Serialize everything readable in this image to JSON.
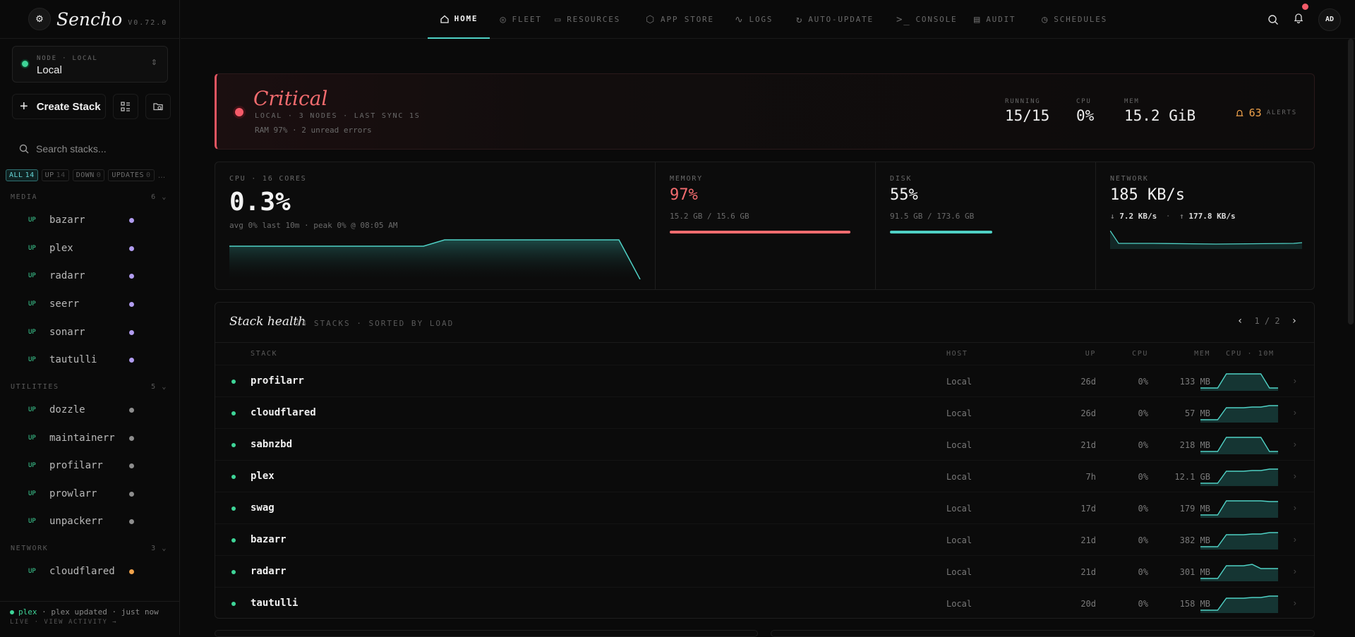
{
  "app": {
    "name": "Sencho",
    "version": "V0.72.0"
  },
  "node": {
    "label": "NODE · LOCAL",
    "value": "Local"
  },
  "sidebar": {
    "create_label": "Create Stack",
    "search_placeholder": "Search stacks...",
    "filters": [
      {
        "label": "ALL",
        "count": "14",
        "active": true
      },
      {
        "label": "UP",
        "count": "14"
      },
      {
        "label": "DOWN",
        "count": "0"
      },
      {
        "label": "UPDATES",
        "count": "0"
      }
    ],
    "groups": [
      {
        "name": "MEDIA",
        "count": "6 ⌄",
        "items": [
          {
            "status": "UP",
            "name": "bazarr",
            "color": "#b19cf0"
          },
          {
            "status": "UP",
            "name": "plex",
            "color": "#b19cf0"
          },
          {
            "status": "UP",
            "name": "radarr",
            "color": "#b19cf0"
          },
          {
            "status": "UP",
            "name": "seerr",
            "color": "#b19cf0"
          },
          {
            "status": "UP",
            "name": "sonarr",
            "color": "#b19cf0"
          },
          {
            "status": "UP",
            "name": "tautulli",
            "color": "#b19cf0"
          }
        ]
      },
      {
        "name": "UTILITIES",
        "count": "5 ⌄",
        "items": [
          {
            "status": "UP",
            "name": "dozzle",
            "color": "#8d8d8d"
          },
          {
            "status": "UP",
            "name": "maintainerr",
            "color": "#8d8d8d"
          },
          {
            "status": "UP",
            "name": "profilarr",
            "color": "#8d8d8d"
          },
          {
            "status": "UP",
            "name": "prowlarr",
            "color": "#8d8d8d"
          },
          {
            "status": "UP",
            "name": "unpackerr",
            "color": "#8d8d8d"
          }
        ]
      },
      {
        "name": "NETWORK",
        "count": "3 ⌄",
        "items": [
          {
            "status": "UP",
            "name": "cloudflared",
            "color": "#f0a24b"
          }
        ]
      }
    ],
    "activity": {
      "name": "plex",
      "text": "· plex updated · just now",
      "line2": "LIVE · VIEW ACTIVITY →"
    }
  },
  "nav": [
    {
      "label": "HOME",
      "icon": "home-icon",
      "active": true
    },
    {
      "label": "FLEET",
      "icon": "fleet-icon"
    },
    {
      "label": "RESOURCES",
      "icon": "resources-icon"
    },
    {
      "label": "APP STORE",
      "icon": "app-store-icon"
    },
    {
      "label": "LOGS",
      "icon": "logs-icon"
    },
    {
      "label": "AUTO-UPDATE",
      "icon": "auto-update-icon"
    },
    {
      "label": "CONSOLE",
      "icon": "console-icon"
    },
    {
      "label": "AUDIT",
      "icon": "audit-icon"
    },
    {
      "label": "SCHEDULES",
      "icon": "schedules-icon"
    }
  ],
  "user": {
    "initials": "AD"
  },
  "banner": {
    "title": "Critical",
    "subtitle": "LOCAL · 3 NODES · LAST SYNC 1S",
    "detail": "RAM 97% · 2 unread errors",
    "stats": [
      {
        "label": "RUNNING",
        "value": "15/15"
      },
      {
        "label": "CPU",
        "value": "0%"
      },
      {
        "label": "MEM",
        "value": "15.2 GiB"
      }
    ],
    "alerts_count": "63",
    "alerts_label": "ALERTS"
  },
  "metrics": {
    "cpu": {
      "label": "CPU · 16 CORES",
      "value": "0.3%",
      "sub": "avg 0% last 10m · peak 0% @ 08:05 AM"
    },
    "memory": {
      "label": "MEMORY",
      "value": "97%",
      "sub": "15.2 GB / 15.6 GB",
      "fill": 0.97,
      "color": "#f36c6f"
    },
    "disk": {
      "label": "DISK",
      "value": "55%",
      "sub": "91.5 GB / 173.6 GB",
      "fill": 0.55,
      "color": "#4fd1c5"
    },
    "network": {
      "label": "NETWORK",
      "value": "185 KB/s",
      "down": "7.2 KB/s",
      "up": "177.8 KB/s"
    }
  },
  "health": {
    "title": "Stack health",
    "subtitle": "14 STACKS · SORTED BY LOAD",
    "page": "1 / 2",
    "columns": {
      "stack": "STACK",
      "host": "HOST",
      "up": "UP",
      "cpu": "CPU",
      "mem": "MEM",
      "spark": "CPU · 10M"
    },
    "rows": [
      {
        "name": "profilarr",
        "host": "Local",
        "up": "26d",
        "cpu": "0%",
        "mem": "133 MB",
        "spark": [
          0,
          0,
          0,
          1,
          1,
          1,
          1,
          1,
          0,
          0
        ]
      },
      {
        "name": "cloudflared",
        "host": "Local",
        "up": "26d",
        "cpu": "0%",
        "mem": "57 MB",
        "spark": [
          0,
          0,
          0,
          0.85,
          0.85,
          0.85,
          0.9,
          0.9,
          1,
          1
        ]
      },
      {
        "name": "sabnzbd",
        "host": "Local",
        "up": "21d",
        "cpu": "0%",
        "mem": "218 MB",
        "spark": [
          0,
          0,
          0,
          1,
          1,
          1,
          1,
          1,
          0,
          0
        ]
      },
      {
        "name": "plex",
        "host": "Local",
        "up": "7h",
        "cpu": "0%",
        "mem": "12.1 GB",
        "spark": [
          0,
          0,
          0,
          0.85,
          0.85,
          0.85,
          0.9,
          0.9,
          1,
          1
        ]
      },
      {
        "name": "swag",
        "host": "Local",
        "up": "17d",
        "cpu": "0%",
        "mem": "179 MB",
        "spark": [
          0,
          0,
          0,
          1,
          1,
          1,
          1,
          1,
          0.95,
          0.95
        ]
      },
      {
        "name": "bazarr",
        "host": "Local",
        "up": "21d",
        "cpu": "0%",
        "mem": "382 MB",
        "spark": [
          0,
          0,
          0,
          0.85,
          0.85,
          0.85,
          0.9,
          0.9,
          1,
          1
        ]
      },
      {
        "name": "radarr",
        "host": "Local",
        "up": "21d",
        "cpu": "0%",
        "mem": "301 MB",
        "spark": [
          0,
          0,
          0,
          0.9,
          0.9,
          0.9,
          1,
          0.7,
          0.7,
          0.7
        ]
      },
      {
        "name": "tautulli",
        "host": "Local",
        "up": "20d",
        "cpu": "0%",
        "mem": "158 MB",
        "spark": [
          0,
          0,
          0,
          0.85,
          0.85,
          0.85,
          0.9,
          0.9,
          1,
          1
        ]
      }
    ]
  },
  "colors": {
    "accent": "#4fd1c5",
    "critical": "#f36c6f",
    "ok": "#3ed598",
    "warn": "#f0a24b"
  }
}
